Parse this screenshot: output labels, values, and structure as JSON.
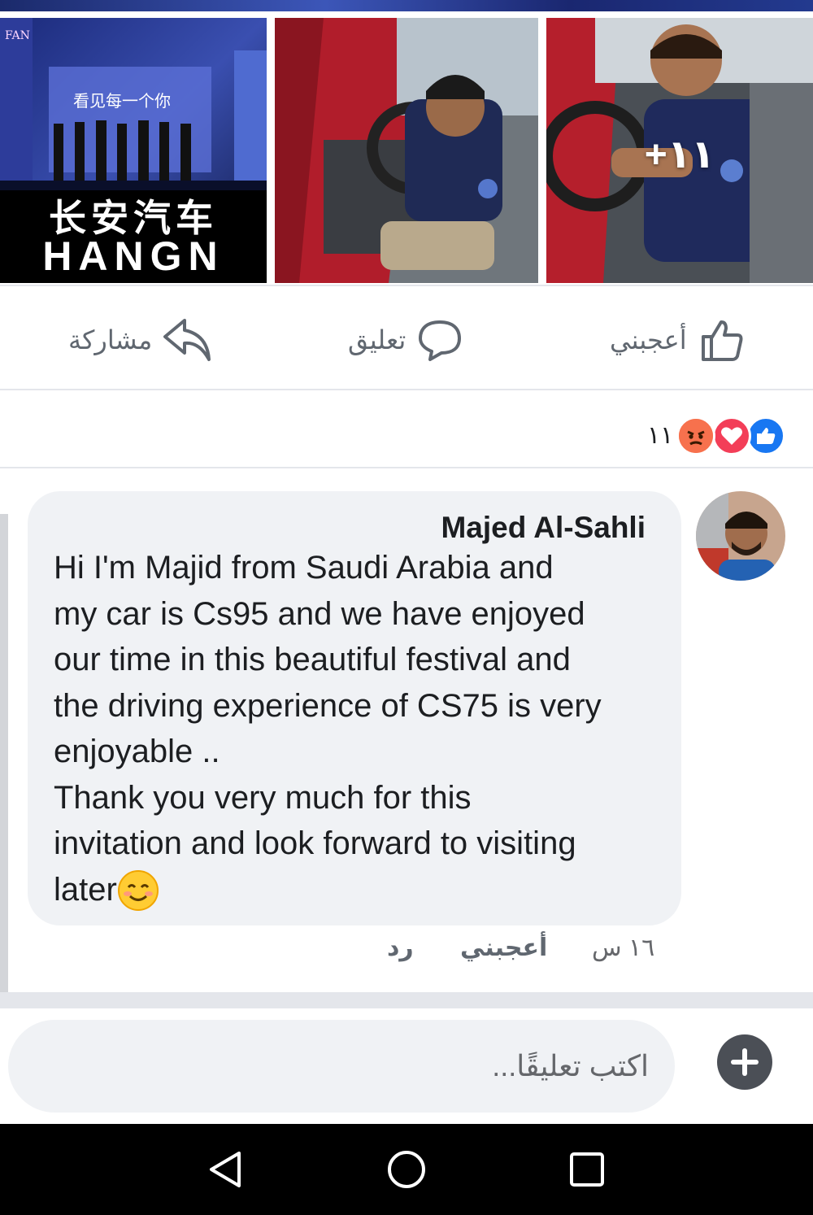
{
  "post": {
    "photos": [
      {
        "name": "stage-photo",
        "caption": "看见每一个你",
        "banner_top": "长安汽车",
        "banner_bottom": "HANGN",
        "credit": "FAN"
      },
      {
        "name": "driver-photo-1"
      },
      {
        "name": "driver-photo-2",
        "more_count": "+١١"
      }
    ],
    "actions": {
      "like_label": "أعجبني",
      "comment_label": "تعليق",
      "share_label": "مشاركة"
    },
    "reactions": {
      "count": "١١",
      "types": [
        "like-icon",
        "love-icon",
        "angry-icon"
      ],
      "colors": {
        "like": "#1877f2",
        "love": "#f33e58",
        "angry": "#f7714d"
      }
    }
  },
  "comment": {
    "author": "Majed Al-Sahli",
    "text": "Hi I'm Majid from Saudi Arabia and\nmy car is Cs95 and we have enjoyed\nour time in this beautiful festival and\nthe driving experience of CS75 is very\nenjoyable ..\nThank you very much for this\ninvitation and look forward to visiting\nlater",
    "emoji": "smiling-face-icon",
    "time": "١٦ س",
    "like_label": "أعجبني",
    "reply_label": "رد"
  },
  "composer": {
    "placeholder": "اكتب تعليقًا..."
  },
  "navbar": {
    "buttons": [
      "back-icon",
      "home-icon",
      "recent-apps-icon"
    ]
  }
}
